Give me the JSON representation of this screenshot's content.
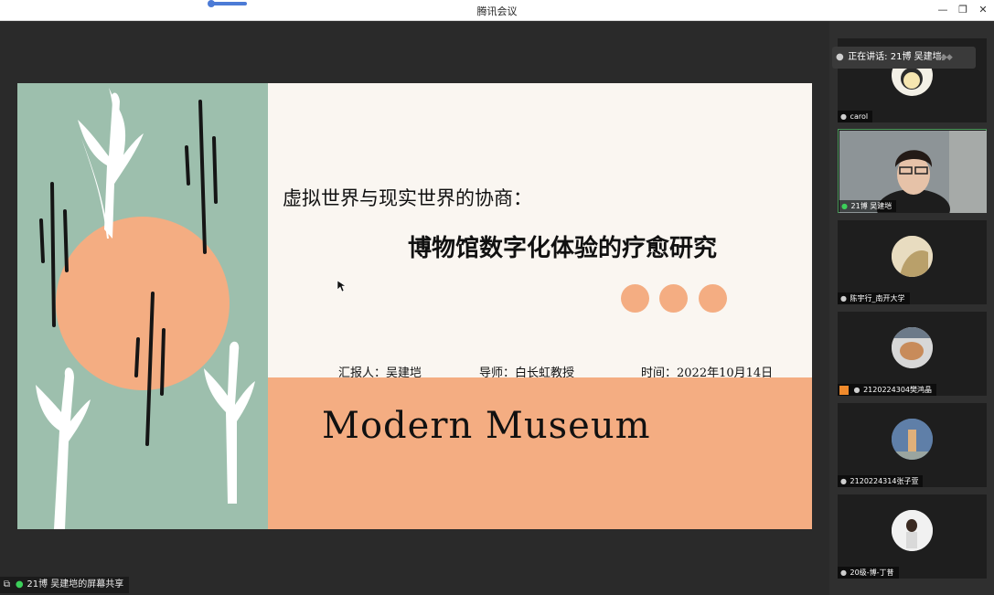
{
  "window": {
    "title": "腾讯会议"
  },
  "slide": {
    "title_line1": "虚拟世界与现实世界的协商：",
    "title_line2": "博物馆数字化体验的疗愈研究",
    "reporter": "汇报人：吴建垲",
    "advisor": "导师：白长虹教授",
    "date": "时间：2022年10月14日",
    "brand": "Modern Museum",
    "colors": {
      "sage": "#9dbfad",
      "peach": "#f4ad82",
      "paper": "#faf6f1"
    }
  },
  "share_status": {
    "label": "21博 吴建垲的屏幕共享"
  },
  "speaking_banner": {
    "label": "正在讲话: 21博 吴建垲;"
  },
  "participants": [
    {
      "name": "carol",
      "mic": "mic-off-icon"
    },
    {
      "name": "21博 吴建垲",
      "mic": "mic-on-icon",
      "active": true
    },
    {
      "name": "陈宇行_南开大学",
      "mic": "mic-off-icon"
    },
    {
      "name": "2120224304樊鸿晶",
      "mic": "mic-off-icon"
    },
    {
      "name": "2120224314张子萱",
      "mic": "mic-off-icon"
    },
    {
      "name": "20级-博-丁普",
      "mic": "mic-off-icon"
    }
  ]
}
